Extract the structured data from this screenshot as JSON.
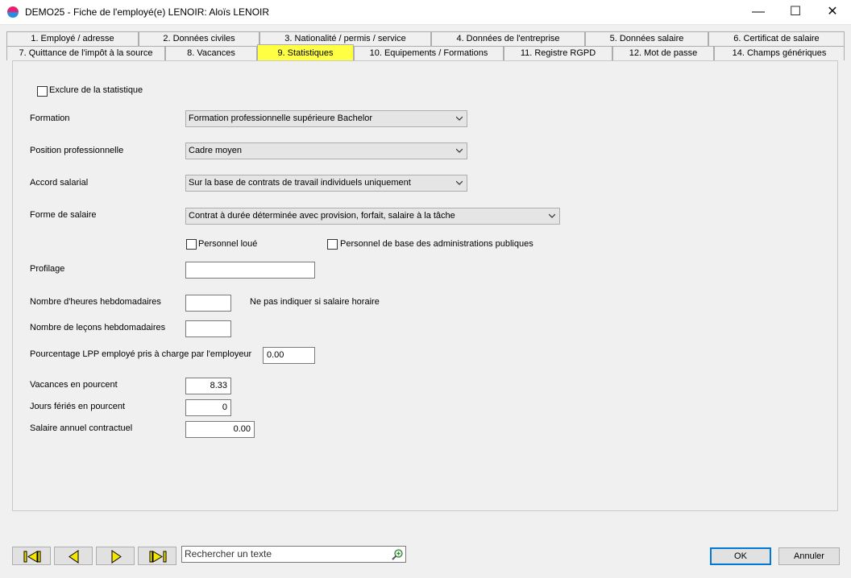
{
  "window": {
    "title": "DEMO25 - Fiche de l'employé(e) LENOIR:  Aloïs LENOIR",
    "minimize": "—",
    "maximize": "☐",
    "close": "✕"
  },
  "tabs_row1": [
    "1. Employé / adresse",
    "2. Données civiles",
    "3. Nationalité / permis / service",
    "4. Données de l'entreprise",
    "5. Données salaire",
    "6. Certificat de salaire"
  ],
  "tabs_row2": [
    "7. Quittance de l'impôt à la source",
    "8. Vacances",
    "9. Statistiques",
    "10. Equipements / Formations",
    "11. Registre RGPD",
    "12. Mot de passe",
    "14. Champs génériques"
  ],
  "form": {
    "exclude_label": "Exclure de la statistique",
    "formation_label": "Formation",
    "formation_value": "Formation professionnelle supérieure Bachelor",
    "position_label": "Position professionnelle",
    "position_value": "Cadre moyen",
    "accord_label": "Accord salarial",
    "accord_value": "Sur la base de contrats de travail individuels uniquement",
    "forme_label": "Forme de salaire",
    "forme_value": "Contrat à durée déterminée avec provision, forfait, salaire à la tâche",
    "personnel_loue_label": "Personnel loué",
    "personnel_base_label": "Personnel de base des administrations publiques",
    "profilage_label": "Profilage",
    "profilage_value": "",
    "heures_label": "Nombre d'heures hebdomadaires",
    "heures_value": "",
    "heures_note": "Ne pas indiquer si salaire horaire",
    "lecons_label": "Nombre de leçons hebdomadaires",
    "lecons_value": "",
    "lpp_label": "Pourcentage LPP employé pris à charge par l'employeur",
    "lpp_value": "0.00",
    "vacances_label": "Vacances en pourcent",
    "vacances_value": "8.33",
    "feries_label": "Jours fériés en pourcent",
    "feries_value": "0",
    "salaire_label": "Salaire annuel contractuel",
    "salaire_value": "0.00"
  },
  "footer": {
    "search_placeholder": "Rechercher un texte",
    "ok_label": "OK",
    "cancel_label": "Annuler"
  },
  "colors": {
    "active_tab": "#ffff44",
    "nav_arrow": "#f5e600"
  }
}
